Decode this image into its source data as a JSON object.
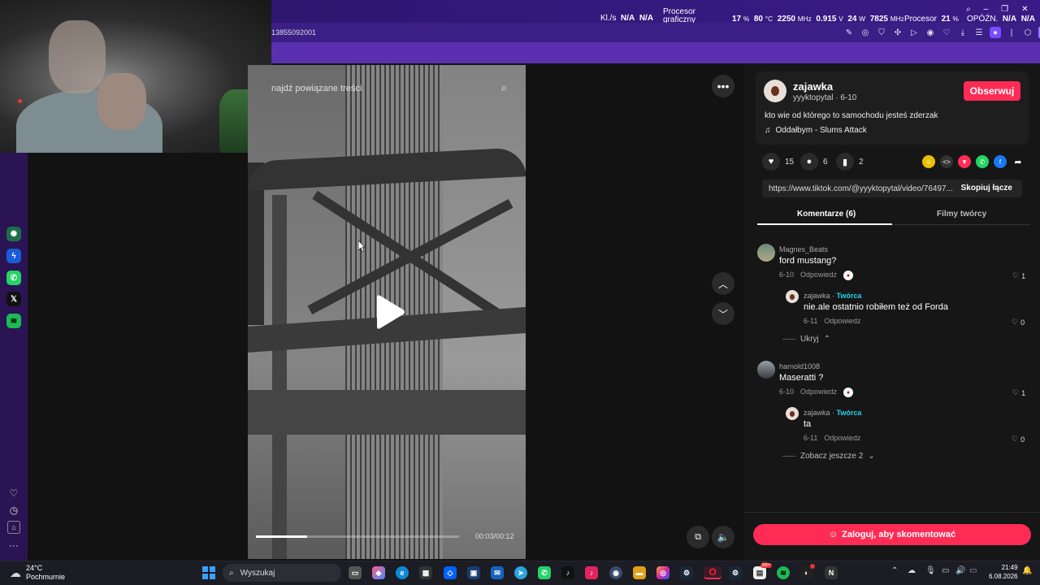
{
  "hud": {
    "kl_label": "Kl./s",
    "kl_val1": "N/A",
    "kl_val2": "N/A",
    "gpu_label_1": "Procesor",
    "gpu_label_2": "graficzny",
    "gpu_load": "17",
    "gpu_load_unit": "%",
    "gpu_temp": "80",
    "gpu_temp_unit": "°C",
    "gpu_clock": "2250",
    "gpu_clock_unit": "MHz",
    "gpu_volt": "0.915",
    "gpu_volt_unit": "V",
    "gpu_power": "24",
    "gpu_power_unit": "W",
    "mem_clock": "7825",
    "mem_clock_unit": "MHz",
    "cpu_label": "Procesor",
    "cpu_load": "21",
    "cpu_load_unit": "%",
    "lat_label": "OPÓŹN.",
    "lat_val1": "N/A",
    "lat_val2": "N/A"
  },
  "browser": {
    "url_fragment": "13855092001",
    "ai_label": "AI"
  },
  "video": {
    "search_placeholder": "najdź powiązane treści",
    "time": "00:03/00:12",
    "progress": 0.25
  },
  "author": {
    "name": "zajawka",
    "handle_date": "yyyktopytal · 6-10",
    "follow_label": "Obserwuj",
    "caption": "kto wie od którego to samochodu jesteś zderzak",
    "music": "Oddałbym - Slums Attack",
    "likes": "15",
    "comments": "6",
    "saves": "2",
    "link": "https://www.tiktok.com/@yyyktopytal/video/76497...",
    "copy_label": "Skopiuj łącze"
  },
  "tabs": {
    "comments": "Komentarze (6)",
    "creator_videos": "Filmy twórcy"
  },
  "comments": [
    {
      "name": "Magnes_Beats",
      "text": "ford mustang?",
      "date": "6-10",
      "reply": "Odpowiedz",
      "likes": "1",
      "sub": {
        "name": "zajawka",
        "sep": " · ",
        "badge": "Twórca",
        "text": "nie.ale ostatnio robiłem też od Forda",
        "date": "6-11",
        "reply": "Odpowiedz",
        "likes": "0"
      },
      "toggle": "Ukryj"
    },
    {
      "name": "harnold1008",
      "text": "Maseratti ?",
      "date": "6-10",
      "reply": "Odpowiedz",
      "likes": "1",
      "sub": {
        "name": "zajawka",
        "sep": " · ",
        "badge": "Twórca",
        "text": "ta",
        "date": "6-11",
        "reply": "Odpowiedz",
        "likes": "0"
      },
      "toggle": "Zobacz jeszcze 2"
    }
  ],
  "login_label": "Zaloguj, aby skomentować",
  "taskbar": {
    "temp": "24°C",
    "weather": "Pochmurnie",
    "search": "Wyszukaj",
    "time": "21:49",
    "date": "6.08.2026",
    "badge": "99+"
  },
  "colors": {
    "accent": "#fe2c55",
    "creator": "#20d5ec",
    "titlebar": "#35197d"
  }
}
